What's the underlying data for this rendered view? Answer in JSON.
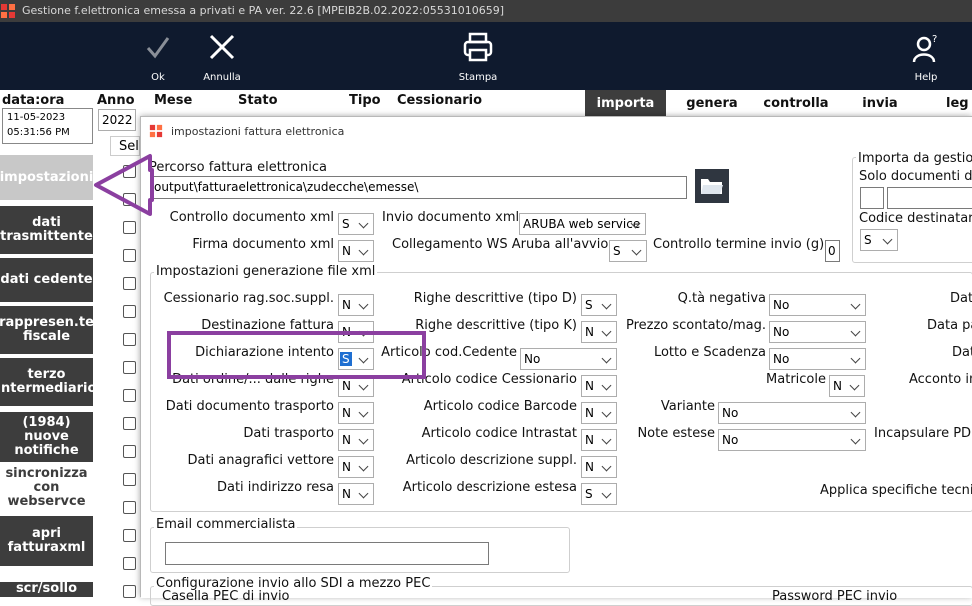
{
  "window": {
    "title": "Gestione f.elettronica emessa a privati e PA  ver. 22.6 [MPEIB2B.02.2022:05531010659]"
  },
  "toolbar": {
    "ok": "Ok",
    "annulla": "Annulla",
    "stampa": "Stampa",
    "help": "Help"
  },
  "header": {
    "dataora": "data:ora",
    "date": "11-05-2023",
    "time": "05:31:56 PM",
    "anno": "Anno",
    "anno_value": "2022",
    "mese": "Mese",
    "stato": "Stato",
    "tipo": "Tipo",
    "cessionario": "Cessionario",
    "sel": "Sel"
  },
  "tabs": [
    "importa",
    "genera",
    "controlla",
    "invia",
    "leg"
  ],
  "sidebar": [
    "impostazioni",
    "dati trasmittente",
    "dati cedente",
    "rappresen.te fiscale",
    "terzo intermediario",
    "(1984) nuove notifiche",
    "sincronizza con webservce",
    "apri fatturaxml",
    "scr/sollo"
  ],
  "dialog": {
    "title": "impostazioni fattura elettronica",
    "percorso_label": "Percorso fattura elettronica",
    "percorso_value": "output\\fatturaelettronica\\zudecche\\emesse\\",
    "controllo_xml": "Controllo documento xml",
    "controllo_xml_val": "S",
    "firma_xml": "Firma documento xml",
    "firma_xml_val": "N",
    "invio_xml": "Invio documento xml",
    "invio_xml_val": "ARUBA web service",
    "collegamento": "Collegamento WS Aruba all'avvio",
    "collegamento_val": "S",
    "controllo_termine": "Controllo termine invio (g)",
    "controllo_termine_val": "0",
    "importa_group": "Importa da gestio",
    "solo_doc": "Solo documenti de",
    "codice_dest": "Codice destinatar",
    "codice_dest_val": "S",
    "impostazioni_group": "Impostazioni generazione file xml",
    "email_group": "Email commercialista",
    "pec_group": "Configurazione invio allo SDI a mezzo PEC",
    "casella_pec": "Casella PEC di invio",
    "password_pec": "Password PEC invio",
    "col1": [
      {
        "label": "Cessionario rag.soc.suppl.",
        "value": "N"
      },
      {
        "label": "Destinazione fattura",
        "value": "N"
      },
      {
        "label": "Dichiarazione intento",
        "value": "S"
      },
      {
        "label": "Dati ordine/... dalle righe",
        "value": "N"
      },
      {
        "label": "Dati documento trasporto",
        "value": "N"
      },
      {
        "label": "Dati trasporto",
        "value": "N"
      },
      {
        "label": "Dati anagrafici vettore",
        "value": "N"
      },
      {
        "label": "Dati indirizzo resa",
        "value": "N"
      }
    ],
    "col2": [
      {
        "label": "Righe descrittive (tipo D)",
        "value": "S"
      },
      {
        "label": "Righe descrittive (tipo K)",
        "value": "N"
      },
      {
        "label": "Articolo cod.Cedente",
        "value": "No"
      },
      {
        "label": "Articolo codice Cessionario",
        "value": "N"
      },
      {
        "label": "Articolo codice Barcode",
        "value": "N"
      },
      {
        "label": "Articolo codice Intrastat",
        "value": "N"
      },
      {
        "label": "Articolo descrizione suppl.",
        "value": "N"
      },
      {
        "label": "Articolo descrizione estesa",
        "value": "S"
      }
    ],
    "col3": [
      {
        "label": "Q.tà negativa",
        "value": "No"
      },
      {
        "label": "Prezzo scontato/mag.",
        "value": "No"
      },
      {
        "label": "Lotto e Scadenza",
        "value": "No"
      },
      {
        "label": "Matricole",
        "value": "N"
      },
      {
        "label": "Variante",
        "value": "No"
      },
      {
        "label": "Note estese",
        "value": "No"
      }
    ],
    "col4": [
      "Dat",
      "Data pa",
      "Dat",
      "Acconto in",
      "",
      "Incapsulare PDF",
      "",
      "Applica specifiche tecni"
    ]
  },
  "colors": {
    "toolbar": "#0f1a2e",
    "sidebar": "#3d3d3d",
    "highlight": "#8b3fa0",
    "selected": "#1f6fd1"
  }
}
